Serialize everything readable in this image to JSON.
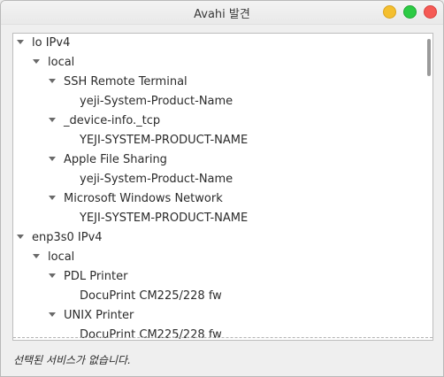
{
  "window": {
    "title": "Avahi 발견"
  },
  "tree": [
    {
      "label": "lo IPv4",
      "expanded": true,
      "level": 0
    },
    {
      "label": "local",
      "expanded": true,
      "level": 1
    },
    {
      "label": "SSH Remote Terminal",
      "expanded": true,
      "level": 2
    },
    {
      "label": "yeji-System-Product-Name",
      "level": 3
    },
    {
      "label": "_device-info._tcp",
      "expanded": true,
      "level": 2
    },
    {
      "label": "YEJI-SYSTEM-PRODUCT-NAME",
      "level": 3
    },
    {
      "label": "Apple File Sharing",
      "expanded": true,
      "level": 2
    },
    {
      "label": "yeji-System-Product-Name",
      "level": 3
    },
    {
      "label": "Microsoft Windows Network",
      "expanded": true,
      "level": 2
    },
    {
      "label": "YEJI-SYSTEM-PRODUCT-NAME",
      "level": 3
    },
    {
      "label": "enp3s0 IPv4",
      "expanded": true,
      "level": 0
    },
    {
      "label": "local",
      "expanded": true,
      "level": 1
    },
    {
      "label": "PDL Printer",
      "expanded": true,
      "level": 2
    },
    {
      "label": "DocuPrint CM225/228 fw",
      "level": 3
    },
    {
      "label": "UNIX Printer",
      "expanded": true,
      "level": 2
    },
    {
      "label": "DocuPrint CM225/228 fw",
      "level": 3
    }
  ],
  "status": {
    "text": "선택된 서비스가 없습니다."
  },
  "icons": {
    "expander": "triangle-down-icon",
    "minimize": "minimize-icon",
    "maximize": "maximize-icon",
    "close": "close-icon"
  }
}
